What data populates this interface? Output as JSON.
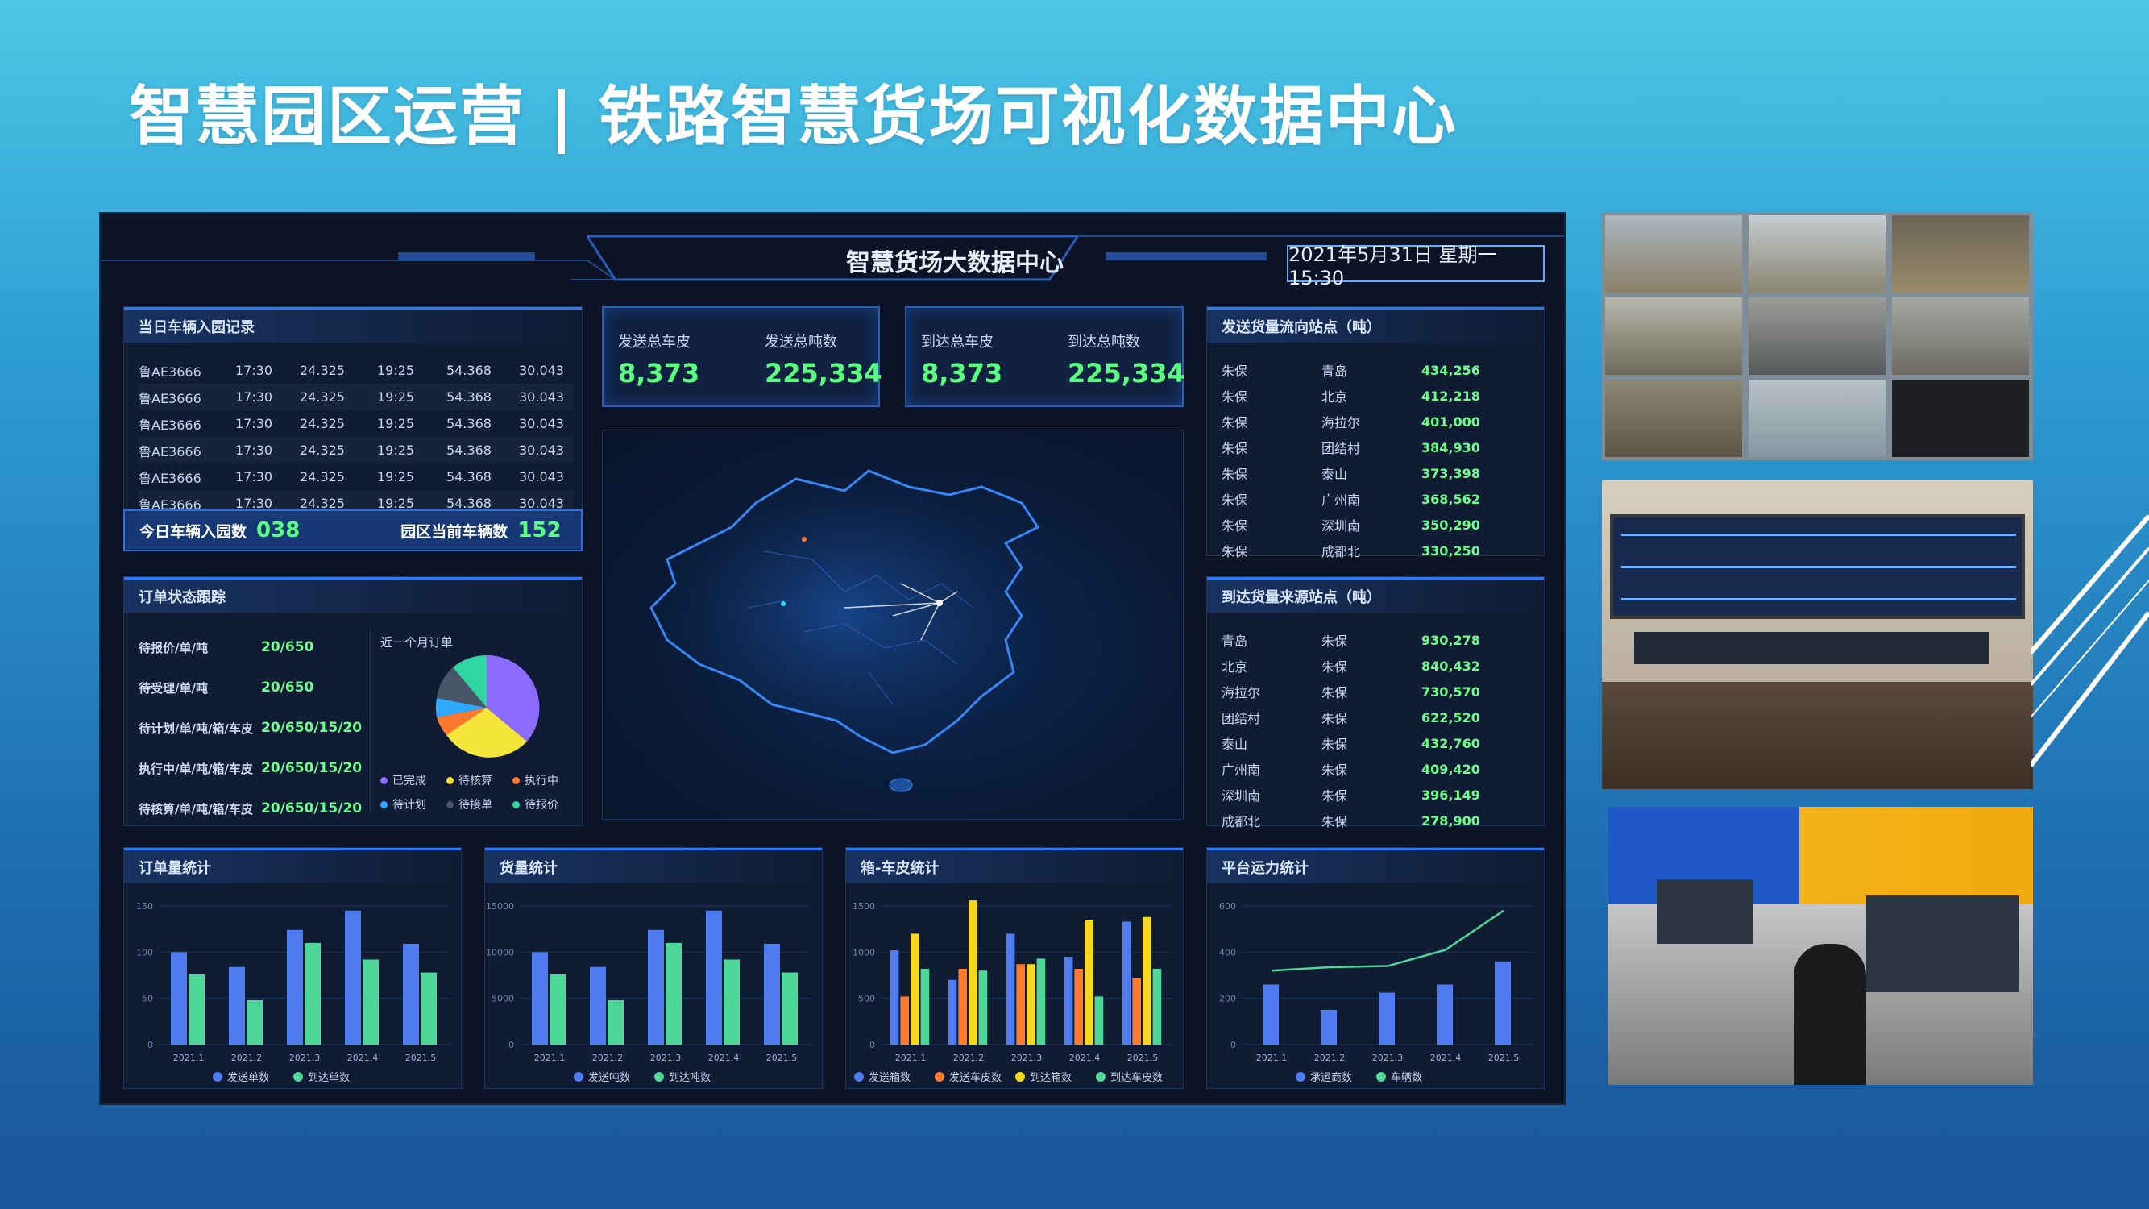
{
  "slide": {
    "title": "智慧园区运营 | 铁路智慧货场可视化数据中心"
  },
  "dashboard": {
    "title": "智慧货场大数据中心",
    "datetime": "2021年5月31日 星期一 15:30",
    "entry_log": {
      "title": "当日车辆入园记录",
      "rows": [
        [
          "鲁AE3666",
          "17:30",
          "24.325",
          "19:25",
          "54.368",
          "30.043"
        ],
        [
          "鲁AE3666",
          "17:30",
          "24.325",
          "19:25",
          "54.368",
          "30.043"
        ],
        [
          "鲁AE3666",
          "17:30",
          "24.325",
          "19:25",
          "54.368",
          "30.043"
        ],
        [
          "鲁AE3666",
          "17:30",
          "24.325",
          "19:25",
          "54.368",
          "30.043"
        ],
        [
          "鲁AE3666",
          "17:30",
          "24.325",
          "19:25",
          "54.368",
          "30.043"
        ],
        [
          "鲁AE3666",
          "17:30",
          "24.325",
          "19:25",
          "54.368",
          "30.043"
        ]
      ],
      "today_label": "今日车辆入园数",
      "today_value": "038",
      "current_label": "园区当前车辆数",
      "current_value": "152"
    },
    "kpis": [
      {
        "label": "发送总车皮",
        "value": "8,373"
      },
      {
        "label": "发送总吨数",
        "value": "225,334"
      },
      {
        "label": "到达总车皮",
        "value": "8,373"
      },
      {
        "label": "到达总吨数",
        "value": "225,334"
      }
    ],
    "send_flow": {
      "title": "发送货量流向站点（吨）",
      "rows": [
        [
          "朱保",
          "青岛",
          "434,256"
        ],
        [
          "朱保",
          "北京",
          "412,218"
        ],
        [
          "朱保",
          "海拉尔",
          "401,000"
        ],
        [
          "朱保",
          "团结村",
          "384,930"
        ],
        [
          "朱保",
          "泰山",
          "373,398"
        ],
        [
          "朱保",
          "广州南",
          "368,562"
        ],
        [
          "朱保",
          "深圳南",
          "350,290"
        ],
        [
          "朱保",
          "成都北",
          "330,250"
        ]
      ]
    },
    "arrive_source": {
      "title": "到达货量来源站点（吨）",
      "rows": [
        [
          "青岛",
          "朱保",
          "930,278"
        ],
        [
          "北京",
          "朱保",
          "840,432"
        ],
        [
          "海拉尔",
          "朱保",
          "730,570"
        ],
        [
          "团结村",
          "朱保",
          "622,520"
        ],
        [
          "泰山",
          "朱保",
          "432,760"
        ],
        [
          "广州南",
          "朱保",
          "409,420"
        ],
        [
          "深圳南",
          "朱保",
          "396,149"
        ],
        [
          "成都北",
          "朱保",
          "278,900"
        ]
      ]
    },
    "order_status": {
      "title": "订单状态跟踪",
      "rows": [
        {
          "label": "待报价/单/吨",
          "value": "20/650"
        },
        {
          "label": "待受理/单/吨",
          "value": "20/650"
        },
        {
          "label": "待计划/单/吨/箱/车皮",
          "value": "20/650/15/20"
        },
        {
          "label": "执行中/单/吨/箱/车皮",
          "value": "20/650/15/20"
        },
        {
          "label": "待核算/单/吨/箱/车皮",
          "value": "20/650/15/20"
        }
      ],
      "pie_title": "近一个月订单",
      "pie_legend": [
        "已完成",
        "待核算",
        "执行中",
        "待计划",
        "待接单",
        "待报价"
      ],
      "pie_colors": [
        "#8b6cff",
        "#f5e43a",
        "#ff7a2f",
        "#2fa8ff",
        "#4a5568",
        "#2fd6a2"
      ]
    }
  },
  "chart_data": [
    {
      "type": "bar",
      "title": "订单量统计",
      "categories": [
        "2021.1",
        "2021.2",
        "2021.3",
        "2021.4",
        "2021.5"
      ],
      "ylim": [
        0,
        150
      ],
      "yticks": [
        "0",
        "50",
        "100",
        "150"
      ],
      "series": [
        {
          "name": "发送单数",
          "values": [
            100,
            84,
            124,
            145,
            109
          ],
          "color": "#4f7df0"
        },
        {
          "name": "到达单数",
          "values": [
            76,
            48,
            110,
            92,
            78
          ],
          "color": "#4fd79a"
        }
      ]
    },
    {
      "type": "bar",
      "title": "货量统计",
      "categories": [
        "2021.1",
        "2021.2",
        "2021.3",
        "2021.4",
        "2021.5"
      ],
      "ylim": [
        0,
        15000
      ],
      "yticks": [
        "0",
        "5000",
        "10000",
        "15000"
      ],
      "series": [
        {
          "name": "发送吨数",
          "values": [
            10000,
            8400,
            12400,
            14500,
            10900
          ],
          "color": "#4f7df0"
        },
        {
          "name": "到达吨数",
          "values": [
            7600,
            4800,
            11000,
            9200,
            7800
          ],
          "color": "#4fd79a"
        }
      ]
    },
    {
      "type": "bar",
      "title": "箱-车皮统计",
      "categories": [
        "2021.1",
        "2021.2",
        "2021.3",
        "2021.4",
        "2021.5"
      ],
      "ylim": [
        0,
        1500
      ],
      "yticks": [
        "0",
        "500",
        "1000",
        "1500"
      ],
      "series": [
        {
          "name": "发送箱数",
          "values": [
            1020,
            700,
            1200,
            950,
            1330
          ],
          "color": "#4f7df0"
        },
        {
          "name": "发送车皮数",
          "values": [
            520,
            820,
            870,
            820,
            720
          ],
          "color": "#ff7a2f"
        },
        {
          "name": "到达箱数",
          "values": [
            1200,
            1560,
            870,
            1350,
            1380
          ],
          "color": "#f5d81e"
        },
        {
          "name": "到达车皮数",
          "values": [
            820,
            800,
            930,
            520,
            820
          ],
          "color": "#4fd79a"
        }
      ]
    },
    {
      "type": "bar",
      "title": "平台运力统计",
      "categories": [
        "2021.1",
        "2021.2",
        "2021.3",
        "2021.4",
        "2021.5"
      ],
      "ylim": [
        0,
        600
      ],
      "yticks": [
        "0",
        "200",
        "400",
        "600"
      ],
      "series": [
        {
          "name": "承运商数",
          "values": [
            260,
            150,
            225,
            260,
            360
          ],
          "color": "#4f7df0",
          "kind": "bar"
        },
        {
          "name": "车辆数",
          "values": [
            320,
            335,
            340,
            410,
            580
          ],
          "color": "#4fd79a",
          "kind": "line"
        }
      ]
    }
  ]
}
